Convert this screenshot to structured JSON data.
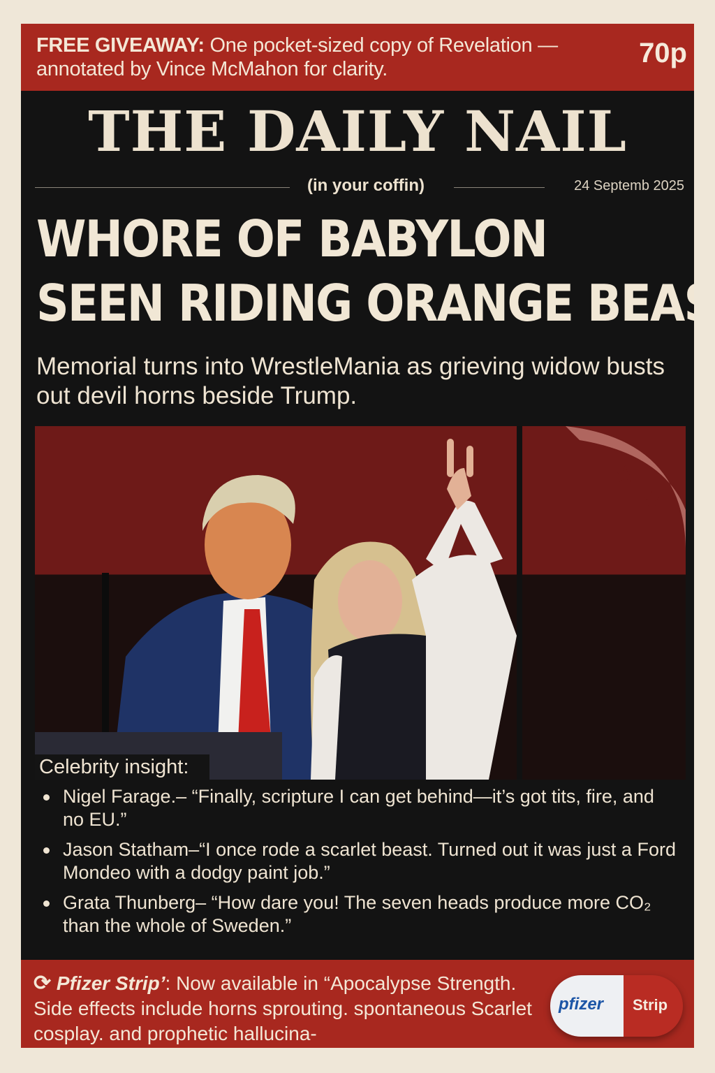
{
  "promo": {
    "label": "FREE GIVEAWAY:",
    "text": " One pocket-sized copy of Revelation — annotated by Vince McMahon for clarity.",
    "price": "70p"
  },
  "masthead": {
    "title": "THE DAILY NAIL",
    "tagline": "(in your coffin)",
    "date": "24 Septemb 2025"
  },
  "story": {
    "headline_line1": "WHORE OF BABYLON",
    "headline_line2": "SEEN RIDING ORANGE BEAST",
    "subhead": "Memorial turns into WrestleMania as grieving widow busts out devil horns beside Trump."
  },
  "celebrity": {
    "title": "Celebrity insight:",
    "quotes": [
      "Nigel Farage.– “Finally, scripture I can get behind—it’s got tits, fire, and no EU.”",
      "Jason Statham–“I once rode a scarlet beast. Turned out it was just a Ford Mondeo with a dodgy paint job.”",
      "Grata Thunberg– “How dare you! The seven heads produce more CO₂ than the whole of Sweden.”"
    ]
  },
  "ad": {
    "brand": "Pfizer Strip’",
    "text": ": Now available in “Apocalypse Strength. Side effects include horns sprouting. spontaneous Scarlet cosplay. and prophetic hallucina-",
    "pill_brand": "pfizer",
    "pill_label": "Strip"
  },
  "colors": {
    "banner_red": "#a8281f",
    "page_black": "#131313",
    "cream": "#efe7d8"
  }
}
